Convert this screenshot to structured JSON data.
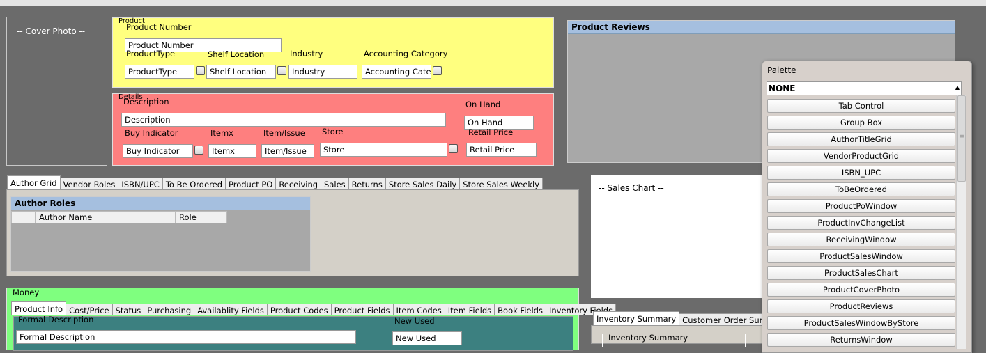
{
  "cover": {
    "label": "-- Cover Photo --"
  },
  "product": {
    "group_title": "Product",
    "number_label": "Product Number",
    "number_value": "Product Number",
    "type_label": "ProductType",
    "type_value": "ProductType",
    "shelf_label": "Shelf Location",
    "shelf_value": "Shelf Location",
    "industry_label": "Industry",
    "industry_value": "Industry",
    "acct_label": "Accounting Category",
    "acct_value": "Accounting Categor"
  },
  "details": {
    "group_title": "Details",
    "description_label": "Description",
    "description_value": "Description",
    "onhand_label": "On Hand",
    "onhand_value": "On Hand",
    "buy_label": "Buy Indicator",
    "buy_value": "Buy Indicator",
    "itemx_label": "Itemx",
    "itemx_value": "Itemx",
    "itemissue_label": "Item/Issue",
    "itemissue_value": "Item/Issue",
    "store_label": "Store",
    "store_value": "Store",
    "retail_label": "Retail Price",
    "retail_value": "Retail Price"
  },
  "reviews": {
    "title": "Product Reviews"
  },
  "author_tabs": [
    "Author Grid",
    "Vendor Roles",
    "ISBN/UPC",
    "To Be Ordered",
    "Product PO",
    "Receiving",
    "Sales",
    "Returns",
    "Store Sales Daily",
    "Store Sales Weekly"
  ],
  "author_roles": {
    "title": "Author Roles",
    "col1": "Author Name",
    "col2": "Role"
  },
  "sales_chart": {
    "label": "-- Sales Chart --"
  },
  "money": {
    "group_title": "Money",
    "tabs": [
      "Product Info",
      "Cost/Price",
      "Status",
      "Purchasing",
      "Availablity Fields",
      "Product Codes",
      "Product Fields",
      "Item Codes",
      "Item Fields",
      "Book Fields",
      "Inventory Fields"
    ],
    "formal_label": "Formal Description",
    "formal_value": "Formal Description",
    "newused_label": "New Used",
    "newused_value": "New Used"
  },
  "inventory": {
    "tabs": [
      "Inventory Summary",
      "Customer Order Summary"
    ],
    "group_title": "Inventory Summary"
  },
  "palette": {
    "title": "Palette",
    "selected": "NONE",
    "items": [
      "Tab Control",
      "Group Box",
      "AuthorTitleGrid",
      "VendorProductGrid",
      "ISBN_UPC",
      "ToBeOrdered",
      "ProductPoWindow",
      "ProductInvChangeList",
      "ReceivingWindow",
      "ProductSalesWindow",
      "ProductSalesChart",
      "ProductCoverPhoto",
      "ProductReviews",
      "ProductSalesWindowByStore",
      "ReturnsWindow"
    ]
  },
  "colors": {
    "product_bg": "#ffff7f",
    "details_bg": "#fe7f7f",
    "money_bg": "#7fff7f",
    "header_bg": "#a5bfdf"
  }
}
